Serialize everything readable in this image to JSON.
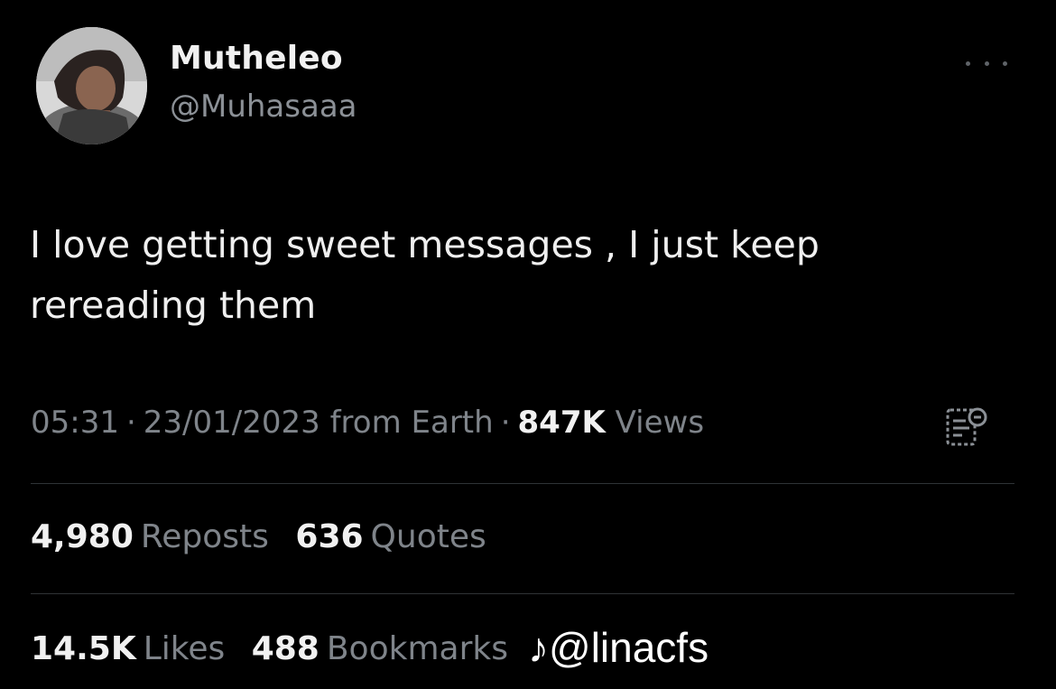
{
  "user": {
    "display_name": "Mutheleo",
    "handle": "@Muhasaaa"
  },
  "tweet": {
    "text_line1": "I love getting sweet messages , I just keep",
    "text_line2": "rereading them",
    "time": "05:31",
    "date": "23/01/2023 from Earth",
    "views_count": "847K",
    "views_label": "Views"
  },
  "stats": {
    "reposts_count": "4,980",
    "reposts_label": "Reposts",
    "quotes_count": "636",
    "quotes_label": "Quotes",
    "likes_count": "14.5K",
    "likes_label": "Likes",
    "bookmarks_count": "488",
    "bookmarks_label": "Bookmarks"
  },
  "watermark": {
    "main": "@linacfs"
  },
  "icons": {
    "more": "more-dots-icon",
    "analytics": "analytics-icon",
    "tiktok": "tiktok-logo-icon"
  },
  "colors": {
    "background": "#000000",
    "primary_text": "#e7e9ea",
    "secondary_text": "#7f848a",
    "divider": "#2f3336"
  }
}
